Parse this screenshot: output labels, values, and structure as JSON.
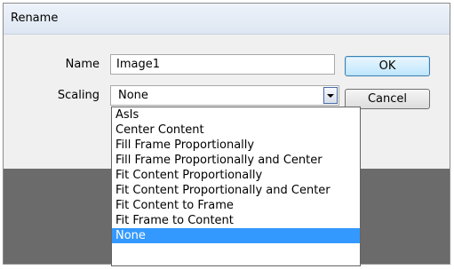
{
  "dialog": {
    "title": "Rename",
    "name_label": "Name",
    "name_value": "Image1",
    "scaling_label": "Scaling",
    "scaling_value": "None",
    "ok_label": "OK",
    "cancel_label": "Cancel"
  },
  "dropdown": {
    "items": [
      "AsIs",
      "Center Content",
      "Fill Frame Proportionally",
      "Fill Frame Proportionally and Center",
      "Fit Content Proportionally",
      "Fit Content Proportionally and Center",
      "Fit Content to Frame",
      "Fit Frame to Content",
      "None"
    ],
    "selected": "None"
  },
  "colors": {
    "highlight": "#3399ff",
    "dialog_bg": "#f0f0f0",
    "canvas_gray": "#6b6b6b"
  },
  "icons": {
    "dropdown_arrow": "chevron-down-icon"
  }
}
